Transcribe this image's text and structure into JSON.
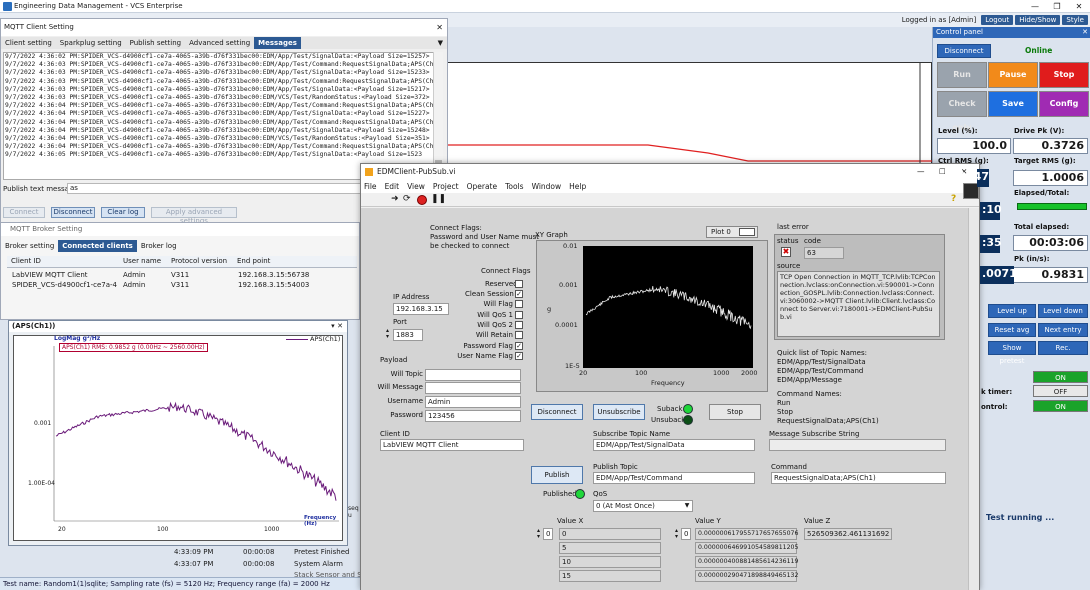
{
  "app": {
    "title": "Engineering Data Management - VCS Enterprise",
    "logged_in": "Logged in as [Admin]",
    "buttons": [
      "Logout",
      "Hide/Show",
      "Style"
    ]
  },
  "control_panel": {
    "title": "Control panel",
    "disconnect": "Disconnect",
    "status": "Online",
    "run": "Run",
    "pause": "Pause",
    "stop": "Stop",
    "check_only": "Check only",
    "save": "Save",
    "config": "Config",
    "level_label": "Level (%):",
    "level_value": "100.0",
    "drive_label": "Drive Pk (V):",
    "drive_value": "0.3726",
    "ctrl_label": "Ctrl RMS (g):",
    "ctrl_value": "0.9847",
    "target_label": "Target RMS (g):",
    "target_value": "1.0006",
    "elapsed_total_label": "Elapsed/Total:",
    "time_left_partial": ":10",
    "total_elapsed_label": "Total elapsed:",
    "left_partial_b": ":35",
    "total_elapsed_value": "00:03:06",
    "pk_label": "Pk (in/s):",
    "left_partial_c": ".0071",
    "pk_value": "0.9831",
    "level_up": "Level up",
    "level_down": "Level down",
    "reset_avg": "Reset avg",
    "next_entry": "Next entry",
    "show_pretest": "Show pretest",
    "rec": "Rec.",
    "toggle_on_1": "ON",
    "timer_label": "k timer:",
    "toggle_off": "OFF",
    "control_label": "ontrol:",
    "toggle_on_2": "ON",
    "test_status": "Test running ..."
  },
  "mqtt": {
    "title": "MQTT Client Setting",
    "tabs": [
      "Client setting",
      "Sparkplug setting",
      "Publish setting",
      "Advanced setting",
      "Messages"
    ],
    "log": [
      "9/7/2022 4:36:02 PM:SPIDER_VCS-d4900cf1-ce7a-4065-a39b-d76f331bec00:EDM/App/Test/SignalData:<Payload Size=15257>",
      "9/7/2022 4:36:03 PM:SPIDER_VCS-d4900cf1-ce7a-4065-a39b-d76f331bec00:EDM/App/Test/Command:RequestSignalData;APS(Ch1)",
      "9/7/2022 4:36:03 PM:SPIDER_VCS-d4900cf1-ce7a-4065-a39b-d76f331bec00:EDM/App/Test/SignalData:<Payload Size=15233>",
      "9/7/2022 4:36:03 PM:SPIDER_VCS-d4900cf1-ce7a-4065-a39b-d76f331bec00:EDM/App/Test/Command:RequestSignalData;APS(Ch1)",
      "9/7/2022 4:36:03 PM:SPIDER_VCS-d4900cf1-ce7a-4065-a39b-d76f331bec00:EDM/App/Test/SignalData:<Payload Size=15217>",
      "9/7/2022 4:36:03 PM:SPIDER_VCS-d4900cf1-ce7a-4065-a39b-d76f331bec00:EDM/VCS/Test/RandomStatus:<Payload Size=372>",
      "9/7/2022 4:36:04 PM:SPIDER_VCS-d4900cf1-ce7a-4065-a39b-d76f331bec00:EDM/App/Test/Command:RequestSignalData;APS(Ch1)",
      "9/7/2022 4:36:04 PM:SPIDER_VCS-d4900cf1-ce7a-4065-a39b-d76f331bec00:EDM/App/Test/SignalData:<Payload Size=15227>",
      "9/7/2022 4:36:04 PM:SPIDER_VCS-d4900cf1-ce7a-4065-a39b-d76f331bec00:EDM/App/Test/Command:RequestSignalData;APS(Ch1)",
      "9/7/2022 4:36:04 PM:SPIDER_VCS-d4900cf1-ce7a-4065-a39b-d76f331bec00:EDM/App/Test/SignalData:<Payload Size=15248>",
      "9/7/2022 4:36:04 PM:SPIDER_VCS-d4900cf1-ce7a-4065-a39b-d76f331bec00:EDM/VCS/Test/RandomStatus:<Payload Size=351>",
      "9/7/2022 4:36:04 PM:SPIDER_VCS-d4900cf1-ce7a-4065-a39b-d76f331bec00:EDM/App/Test/Command:RequestSignalData;APS(Ch1)",
      "9/7/2022 4:36:05 PM:SPIDER_VCS-d4900cf1-ce7a-4065-a39b-d76f331bec00:EDM/App/Test/SignalData:<Payload Size=1523"
    ],
    "publish_text_label": "Publish text message",
    "publish_text_value": "as",
    "buttons": [
      "Connect",
      "Disconnect",
      "Clear log",
      "Apply advanced settings"
    ]
  },
  "broker": {
    "title": "MQTT Broker Setting",
    "tabs": [
      "Broker setting",
      "Connected clients",
      "Broker log"
    ],
    "columns": [
      "Client ID",
      "User name",
      "Protocol version",
      "End point"
    ],
    "rows": [
      [
        "LabVIEW MQTT Client",
        "Admin",
        "V311",
        "192.168.3.15:56738"
      ],
      [
        "SPIDER_VCS-d4900cf1-ce7a-4065-...",
        "Admin",
        "V311",
        "192.168.3.15:54003"
      ]
    ]
  },
  "aps": {
    "title": "(APS(Ch1))",
    "ylabel": "LogMag g²/Hz",
    "legend": "APS(Ch1)",
    "annotation": "APS(Ch1) RMS: 0.9852 g (0.00Hz ~ 2560.00Hz)",
    "xlabel": "Frequency (Hz)",
    "yticks": [
      "0.001",
      "1.00E-04"
    ],
    "xticks": [
      "20",
      "100",
      "1000"
    ]
  },
  "events": [
    [
      "4:33:09 PM",
      "00:00:08",
      "Pretest Finished"
    ],
    [
      "4:33:07 PM",
      "00:00:08",
      "System Alarm"
    ]
  ],
  "events_cut": "Stack Sensor and Sens",
  "side_letter": "sequ",
  "statusbar": "Test name: Random1(1)sqlite; Sampling rate (fs) = 5120 Hz; Frequency range (fa) = 2000 Hz",
  "vi": {
    "title": "EDMClient-PubSub.vi",
    "menu": [
      "File",
      "Edit",
      "View",
      "Project",
      "Operate",
      "Tools",
      "Window",
      "Help"
    ],
    "connect_flags_note": "Connect Flags:\nPassword and User Name must\nbe checked to connect",
    "connect_flags_title": "Connect Flags",
    "flags": [
      {
        "label": "Reserved",
        "checked": false
      },
      {
        "label": "Clean Session",
        "checked": true
      },
      {
        "label": "Will Flag",
        "checked": false
      },
      {
        "label": "Will QoS 1",
        "checked": false
      },
      {
        "label": "Will QoS 2",
        "checked": false
      },
      {
        "label": "Will Retain",
        "checked": false
      },
      {
        "label": "Password Flag",
        "checked": true
      },
      {
        "label": "User Name Flag",
        "checked": true
      }
    ],
    "ip_label": "IP Address",
    "ip_value": "192.168.3.15",
    "port_label": "Port",
    "port_value": "1883",
    "payload_label": "Payload",
    "will_topic_label": "Will Topic",
    "will_message_label": "Will Message",
    "username_label": "Username",
    "username_value": "Admin",
    "password_label": "Password",
    "password_value": "123456",
    "xy_graph_label": "XY Graph",
    "plot_legend": "Plot 0",
    "graph_yticks": [
      "0.01",
      "0.001",
      "0.0001",
      "1E-5"
    ],
    "graph_xticks": [
      "20",
      "100",
      "1000",
      "2000"
    ],
    "graph_xlabel": "Frequency",
    "graph_ylabel": "g",
    "last_error": "last error",
    "status_label": "status",
    "code_label": "code",
    "code_value": "63",
    "source_label": "source",
    "source_text": "TCP Open Connection in MQTT_TCP.lvlib:TCPConnection.lvclass:onConnection.vi:590001->Connection_GOSPL.lvlib:Connection.lvclass:Connect.vi:3060002->MQTT Client.lvlib:Client.lvclass:Connect to Server.vi:7180001->EDMClient-PubSub.vi",
    "topics_title": "Quick list of Topic Names:",
    "topics": [
      "EDM/App/Test/SignalData",
      "EDM/App/Test/Command",
      "EDM/App/Message"
    ],
    "commands_title": "Command Names:",
    "commands": [
      "Run",
      "Stop",
      "RequestSignalData;APS(Ch1)"
    ],
    "disconnect_btn": "Disconnect",
    "unsubscribe_btn": "Unsubscribe",
    "suback": "Suback",
    "unsuback": "Unsuback",
    "stop_btn": "Stop",
    "client_id_label": "Client ID",
    "client_id_value": "LabVIEW MQTT Client",
    "subscribe_topic_label": "Subscribe Topic Name",
    "subscribe_topic_value": "EDM/App/Test/SignalData",
    "msg_subscribe_label": "Message Subscribe String",
    "publish_btn": "Publish",
    "published_label": "Published",
    "publish_topic_label": "Publish Topic",
    "publish_topic_value": "EDM/App/Test/Command",
    "command_label": "Command",
    "command_value": "RequestSignalData;APS(Ch1)",
    "qos_label": "QoS",
    "qos_value": "0 (At Most Once)",
    "value_x_label": "Value X",
    "value_y_label": "Value Y",
    "value_z_label": "Value Z",
    "index_x": "0",
    "index_y": "0",
    "value_x": [
      "0",
      "5",
      "10",
      "15"
    ],
    "value_y": [
      "0.000000617955717657655076",
      "0.000000646991054589811205",
      "0.000000400881485614236119",
      "0.000000290471898849465132"
    ],
    "value_z": "526509362.461131692"
  }
}
